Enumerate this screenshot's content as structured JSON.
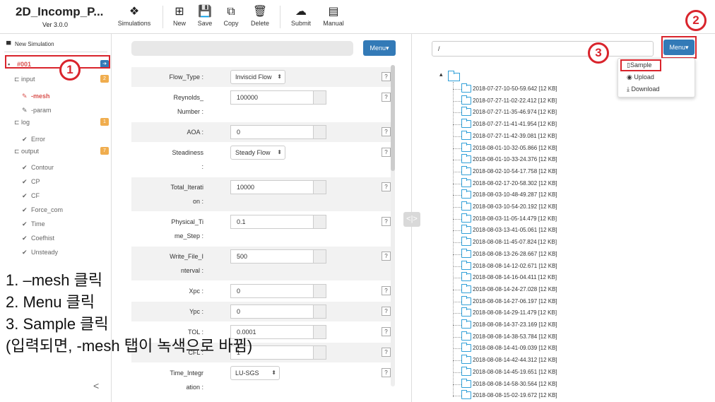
{
  "app": {
    "title": "2D_Incomp_P...",
    "version": "Ver 3.0.0"
  },
  "toolbar": [
    {
      "key": "simulations",
      "label": "Simulations",
      "icon": "cubes-icon",
      "glyph": "❖"
    },
    {
      "key": "new",
      "label": "New",
      "icon": "plus-square-icon",
      "glyph": "⊞"
    },
    {
      "key": "save",
      "label": "Save",
      "icon": "floppy-icon",
      "glyph": "💾"
    },
    {
      "key": "copy",
      "label": "Copy",
      "icon": "copy-icon",
      "glyph": "⧉"
    },
    {
      "key": "delete",
      "label": "Delete",
      "icon": "trash-icon",
      "glyph": "🗑"
    },
    {
      "key": "submit",
      "label": "Submit",
      "icon": "cloud-upload-icon",
      "glyph": "☁"
    },
    {
      "key": "manual",
      "label": "Manual",
      "icon": "book-icon",
      "glyph": "▤"
    }
  ],
  "sidebar": {
    "new_simulation": "New Simulation",
    "sim_id": "#001",
    "sim_badge": "➔",
    "input": {
      "label": "input",
      "count": "2"
    },
    "mesh": "-mesh",
    "param": "-param",
    "log": {
      "label": "log",
      "count": "1"
    },
    "error": "Error",
    "output": {
      "label": "output",
      "count": "7"
    },
    "outputs": [
      "Contour",
      "CP",
      "CF",
      "Force_com",
      "Time",
      "Coefhist",
      "Unsteady"
    ],
    "collapse": "<"
  },
  "form": {
    "menu_label": "Menu▾",
    "help": "?",
    "rows": [
      {
        "label1": "Flow_Type :",
        "label2": "",
        "kind": "select",
        "value": "Inviscid Flow"
      },
      {
        "label1": "Reynolds_",
        "label2": "Number :",
        "kind": "input",
        "value": "100000"
      },
      {
        "label1": "AOA :",
        "label2": "",
        "kind": "input",
        "value": "0"
      },
      {
        "label1": "Steadiness",
        "label2": ":",
        "kind": "select",
        "value": "Steady Flow"
      },
      {
        "label1": "Total_Iterati",
        "label2": "on :",
        "kind": "input",
        "value": "10000"
      },
      {
        "label1": "Physical_Ti",
        "label2": "me_Step :",
        "kind": "input",
        "value": "0.1"
      },
      {
        "label1": "Write_File_I",
        "label2": "nterval :",
        "kind": "input",
        "value": "500"
      },
      {
        "label1": "Xpc :",
        "label2": "",
        "kind": "input",
        "value": "0"
      },
      {
        "label1": "Ypc :",
        "label2": "",
        "kind": "input",
        "value": "0"
      },
      {
        "label1": "TOL :",
        "label2": "",
        "kind": "input",
        "value": "0.0001"
      },
      {
        "label1": "CFL :",
        "label2": "",
        "kind": "input",
        "value": "1"
      },
      {
        "label1": "Time_Integr",
        "label2": "ation :",
        "kind": "select",
        "value": "LU-SGS"
      }
    ]
  },
  "splitter": "<|>",
  "files": {
    "path": "/",
    "menu_label": "Menu▾",
    "dropdown": [
      "Sample",
      "Upload",
      "Download"
    ],
    "tree": [
      "2018-07-27-10-50-59.642 [12 KB]",
      "2018-07-27-11-02-22.412 [12 KB]",
      "2018-07-27-11-35-46.974 [12 KB]",
      "2018-07-27-11-41-41.954 [12 KB]",
      "2018-07-27-11-42-39.081 [12 KB]",
      "2018-08-01-10-32-05.866 [12 KB]",
      "2018-08-01-10-33-24.376 [12 KB]",
      "2018-08-02-10-54-17.758 [12 KB]",
      "2018-08-02-17-20-58.302 [12 KB]",
      "2018-08-03-10-48-49.287 [12 KB]",
      "2018-08-03-10-54-20.192 [12 KB]",
      "2018-08-03-11-05-14.479 [12 KB]",
      "2018-08-03-13-41-05.061 [12 KB]",
      "2018-08-08-11-45-07.824 [12 KB]",
      "2018-08-08-13-26-28.667 [12 KB]",
      "2018-08-08-14-12-02.671 [12 KB]",
      "2018-08-08-14-16-04.411 [12 KB]",
      "2018-08-08-14-24-27.028 [12 KB]",
      "2018-08-08-14-27-06.197 [12 KB]",
      "2018-08-08-14-29-11.479 [12 KB]",
      "2018-08-08-14-37-23.169 [12 KB]",
      "2018-08-08-14-38-53.784 [12 KB]",
      "2018-08-08-14-41-09.039 [12 KB]",
      "2018-08-08-14-42-44.312 [12 KB]",
      "2018-08-08-14-45-19.651 [12 KB]",
      "2018-08-08-14-58-30.564 [12 KB]",
      "2018-08-08-15-02-19.672 [12 KB]"
    ]
  },
  "annotations": {
    "step1": "1",
    "step2": "2",
    "step3": "3",
    "highlight_color": "#d9242c"
  },
  "instructions": [
    "1. –mesh 클릭",
    "2. Menu 클릭",
    "3. Sample 클릭",
    "(입력되면, -mesh 탭이 녹색으로 바뀜)"
  ]
}
